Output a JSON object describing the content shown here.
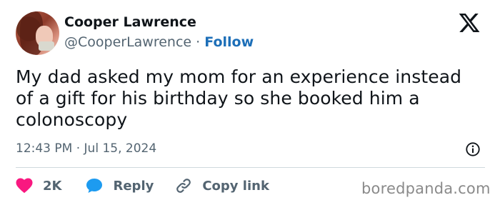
{
  "author": {
    "name": "Cooper Lawrence",
    "handle": "@CooperLawrence",
    "separator": "·",
    "follow_label": "Follow"
  },
  "tweet": {
    "lines": [
      "My dad asked my mom for an experience instead",
      "of a gift for his birthday so she booked him a",
      "colonoscopy"
    ],
    "timestamp": "12:43 PM · Jul 15, 2024"
  },
  "actions": {
    "like_count": "2K",
    "reply_label": "Reply",
    "copy_label": "Copy link"
  },
  "watermark": "boredpanda.com",
  "icons": {
    "brand": "x-logo-icon",
    "info": "info-icon",
    "like": "heart-icon",
    "reply": "speech-bubble-icon",
    "copy": "link-icon"
  },
  "colors": {
    "text": "#0f1419",
    "secondary": "#536471",
    "follow": "#1d6fb8",
    "heart": "#f91880",
    "reply_bubble": "#1d9bf0",
    "divider": "#cfd9de"
  }
}
